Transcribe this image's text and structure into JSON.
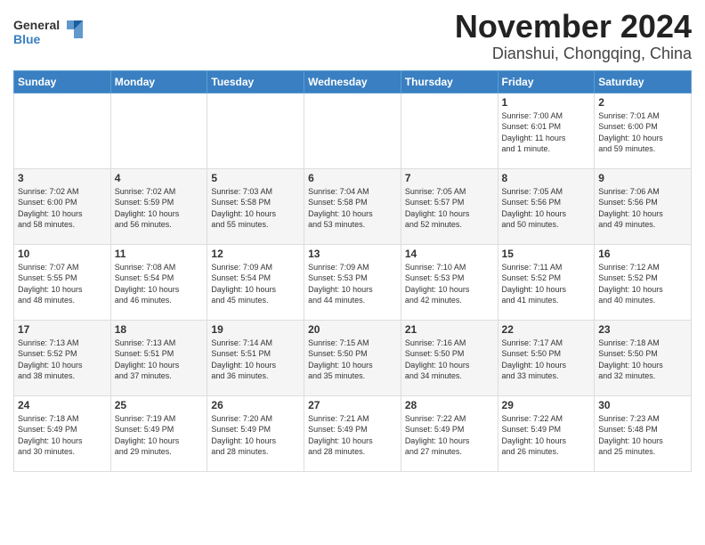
{
  "logo": {
    "general": "General",
    "blue": "Blue"
  },
  "title": "November 2024",
  "location": "Dianshui, Chongqing, China",
  "days_header": [
    "Sunday",
    "Monday",
    "Tuesday",
    "Wednesday",
    "Thursday",
    "Friday",
    "Saturday"
  ],
  "weeks": [
    [
      {
        "day": "",
        "info": ""
      },
      {
        "day": "",
        "info": ""
      },
      {
        "day": "",
        "info": ""
      },
      {
        "day": "",
        "info": ""
      },
      {
        "day": "",
        "info": ""
      },
      {
        "day": "1",
        "info": "Sunrise: 7:00 AM\nSunset: 6:01 PM\nDaylight: 11 hours\nand 1 minute."
      },
      {
        "day": "2",
        "info": "Sunrise: 7:01 AM\nSunset: 6:00 PM\nDaylight: 10 hours\nand 59 minutes."
      }
    ],
    [
      {
        "day": "3",
        "info": "Sunrise: 7:02 AM\nSunset: 6:00 PM\nDaylight: 10 hours\nand 58 minutes."
      },
      {
        "day": "4",
        "info": "Sunrise: 7:02 AM\nSunset: 5:59 PM\nDaylight: 10 hours\nand 56 minutes."
      },
      {
        "day": "5",
        "info": "Sunrise: 7:03 AM\nSunset: 5:58 PM\nDaylight: 10 hours\nand 55 minutes."
      },
      {
        "day": "6",
        "info": "Sunrise: 7:04 AM\nSunset: 5:58 PM\nDaylight: 10 hours\nand 53 minutes."
      },
      {
        "day": "7",
        "info": "Sunrise: 7:05 AM\nSunset: 5:57 PM\nDaylight: 10 hours\nand 52 minutes."
      },
      {
        "day": "8",
        "info": "Sunrise: 7:05 AM\nSunset: 5:56 PM\nDaylight: 10 hours\nand 50 minutes."
      },
      {
        "day": "9",
        "info": "Sunrise: 7:06 AM\nSunset: 5:56 PM\nDaylight: 10 hours\nand 49 minutes."
      }
    ],
    [
      {
        "day": "10",
        "info": "Sunrise: 7:07 AM\nSunset: 5:55 PM\nDaylight: 10 hours\nand 48 minutes."
      },
      {
        "day": "11",
        "info": "Sunrise: 7:08 AM\nSunset: 5:54 PM\nDaylight: 10 hours\nand 46 minutes."
      },
      {
        "day": "12",
        "info": "Sunrise: 7:09 AM\nSunset: 5:54 PM\nDaylight: 10 hours\nand 45 minutes."
      },
      {
        "day": "13",
        "info": "Sunrise: 7:09 AM\nSunset: 5:53 PM\nDaylight: 10 hours\nand 44 minutes."
      },
      {
        "day": "14",
        "info": "Sunrise: 7:10 AM\nSunset: 5:53 PM\nDaylight: 10 hours\nand 42 minutes."
      },
      {
        "day": "15",
        "info": "Sunrise: 7:11 AM\nSunset: 5:52 PM\nDaylight: 10 hours\nand 41 minutes."
      },
      {
        "day": "16",
        "info": "Sunrise: 7:12 AM\nSunset: 5:52 PM\nDaylight: 10 hours\nand 40 minutes."
      }
    ],
    [
      {
        "day": "17",
        "info": "Sunrise: 7:13 AM\nSunset: 5:52 PM\nDaylight: 10 hours\nand 38 minutes."
      },
      {
        "day": "18",
        "info": "Sunrise: 7:13 AM\nSunset: 5:51 PM\nDaylight: 10 hours\nand 37 minutes."
      },
      {
        "day": "19",
        "info": "Sunrise: 7:14 AM\nSunset: 5:51 PM\nDaylight: 10 hours\nand 36 minutes."
      },
      {
        "day": "20",
        "info": "Sunrise: 7:15 AM\nSunset: 5:50 PM\nDaylight: 10 hours\nand 35 minutes."
      },
      {
        "day": "21",
        "info": "Sunrise: 7:16 AM\nSunset: 5:50 PM\nDaylight: 10 hours\nand 34 minutes."
      },
      {
        "day": "22",
        "info": "Sunrise: 7:17 AM\nSunset: 5:50 PM\nDaylight: 10 hours\nand 33 minutes."
      },
      {
        "day": "23",
        "info": "Sunrise: 7:18 AM\nSunset: 5:50 PM\nDaylight: 10 hours\nand 32 minutes."
      }
    ],
    [
      {
        "day": "24",
        "info": "Sunrise: 7:18 AM\nSunset: 5:49 PM\nDaylight: 10 hours\nand 30 minutes."
      },
      {
        "day": "25",
        "info": "Sunrise: 7:19 AM\nSunset: 5:49 PM\nDaylight: 10 hours\nand 29 minutes."
      },
      {
        "day": "26",
        "info": "Sunrise: 7:20 AM\nSunset: 5:49 PM\nDaylight: 10 hours\nand 28 minutes."
      },
      {
        "day": "27",
        "info": "Sunrise: 7:21 AM\nSunset: 5:49 PM\nDaylight: 10 hours\nand 28 minutes."
      },
      {
        "day": "28",
        "info": "Sunrise: 7:22 AM\nSunset: 5:49 PM\nDaylight: 10 hours\nand 27 minutes."
      },
      {
        "day": "29",
        "info": "Sunrise: 7:22 AM\nSunset: 5:49 PM\nDaylight: 10 hours\nand 26 minutes."
      },
      {
        "day": "30",
        "info": "Sunrise: 7:23 AM\nSunset: 5:48 PM\nDaylight: 10 hours\nand 25 minutes."
      }
    ]
  ]
}
